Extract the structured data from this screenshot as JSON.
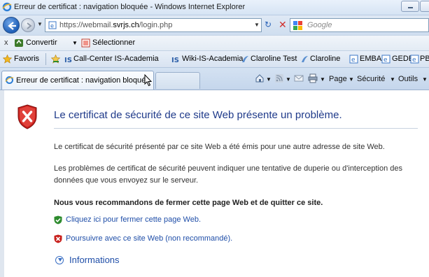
{
  "window": {
    "title": "Erreur de certificat : navigation bloquée - Windows Internet Explorer"
  },
  "address_bar": {
    "url_prefix": "https://webmail.",
    "url_domain": "svrjs.ch",
    "url_suffix": "/login.php",
    "search_placeholder": "Google"
  },
  "convert_toolbar": {
    "close_label": "x",
    "convert_label": "Convertir",
    "select_label": "Sélectionner"
  },
  "favorites_bar": {
    "favorites_label": "Favoris",
    "items": [
      {
        "label": "Call-Center IS-Academia",
        "icon": "is-academia-icon"
      },
      {
        "label": "Wiki-IS-Academia",
        "icon": "is-academia-icon"
      },
      {
        "label": "Claroline Test",
        "icon": "claroline-icon"
      },
      {
        "label": "Claroline",
        "icon": "claroline-icon"
      },
      {
        "label": "EMBA",
        "icon": "ie-page-icon"
      },
      {
        "label": "GEDE",
        "icon": "ie-page-icon"
      },
      {
        "label": "PBOI",
        "icon": "ie-page-icon"
      }
    ]
  },
  "tabs": {
    "active_label": "Erreur de certificat : navigation bloquée"
  },
  "command_bar": {
    "page_label": "Page",
    "security_label": "Sécurité",
    "tools_label": "Outils"
  },
  "content": {
    "heading": "Le certificat de sécurité de ce site Web présente un problème.",
    "para1": "Le certificat de sécurité présenté par ce site Web a été émis pour une autre adresse de site Web.",
    "para2_line1": "Les problèmes de certificat de sécurité peuvent indiquer une tentative de duperie ou d'interception des",
    "para2_line2": "données que vous envoyez sur le serveur.",
    "recommendation": "Nous vous recommandons de fermer cette page Web et de quitter ce site.",
    "close_link": "Cliquez ici pour fermer cette page Web.",
    "continue_link": "Poursuivre avec ce site Web (non recommandé).",
    "info_label": "Informations"
  },
  "colors": {
    "heading": "#1f3a8a",
    "link": "#1f4ea8",
    "shield_red": "#c8201c",
    "safe_green": "#2e8b2e"
  }
}
